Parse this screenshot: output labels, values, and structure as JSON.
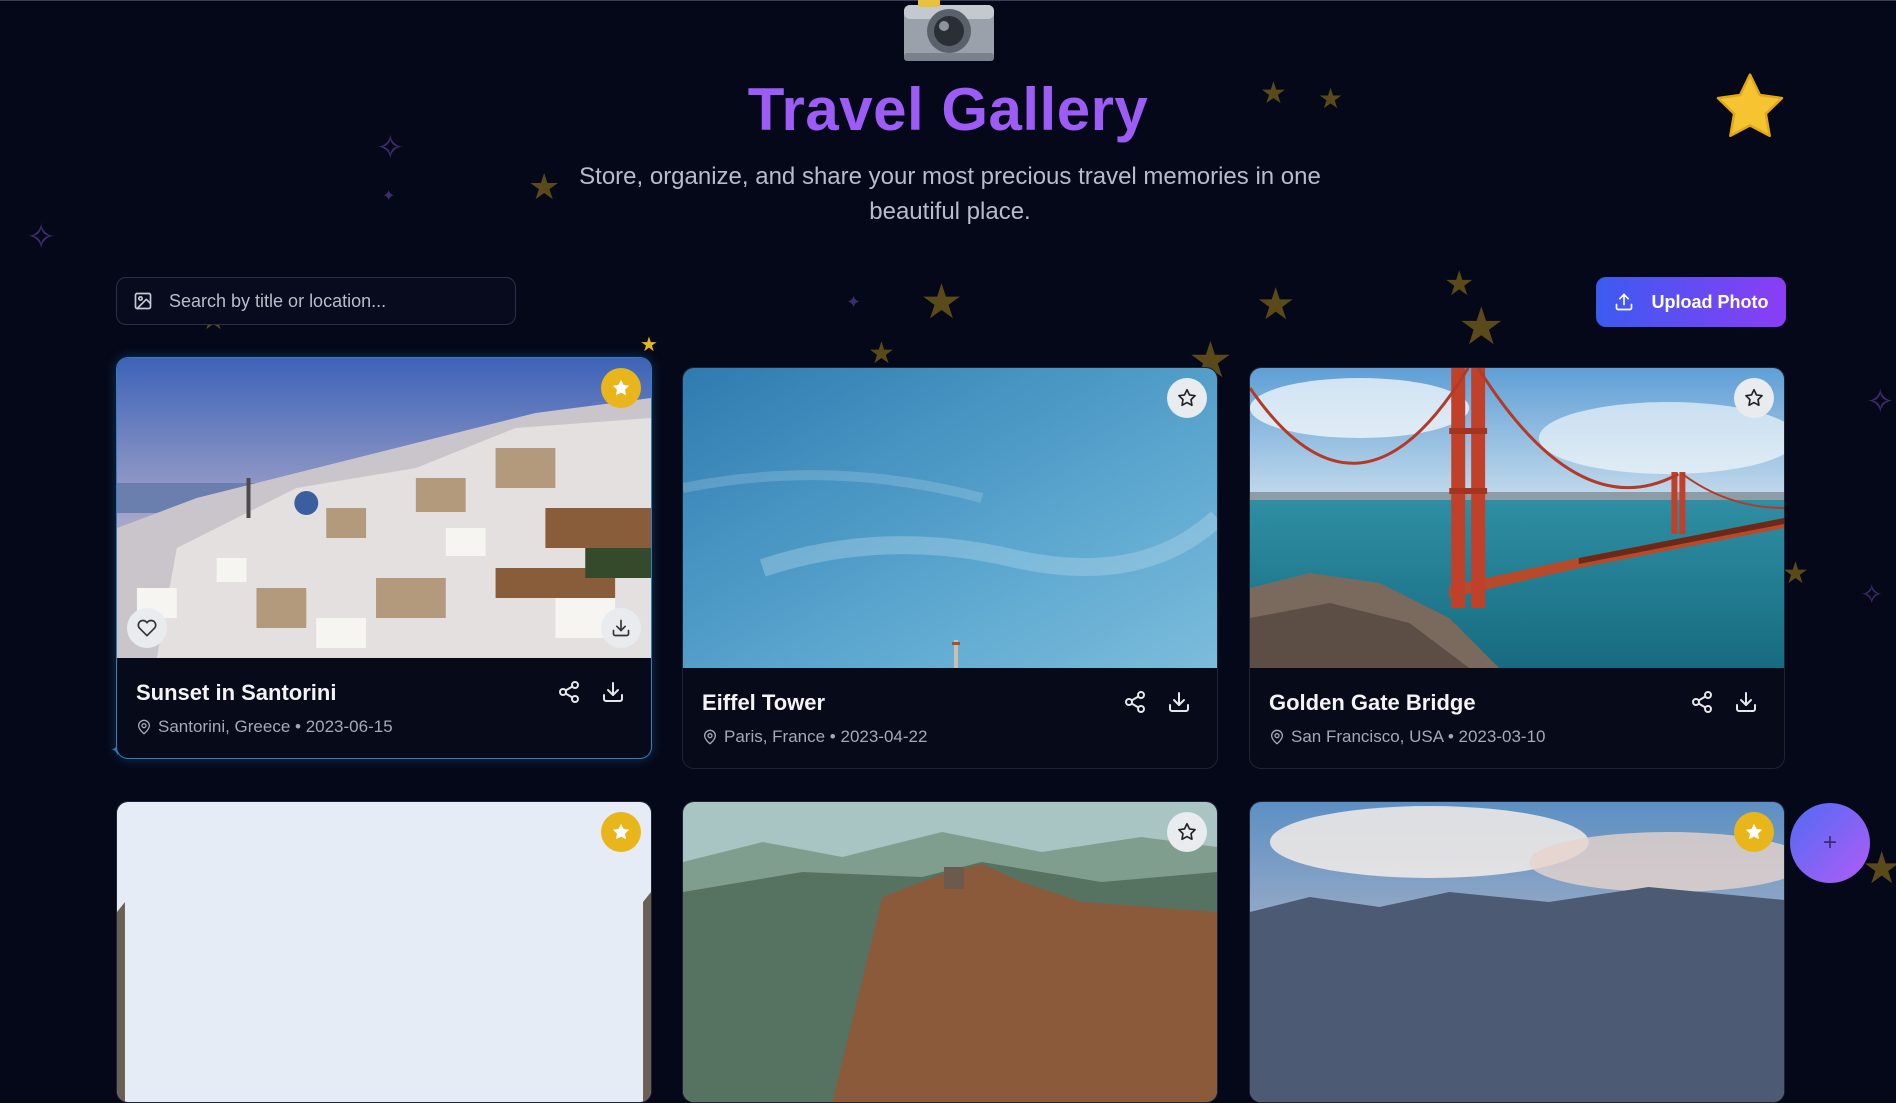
{
  "header": {
    "title": "Travel Gallery",
    "subtitle": "Store, organize, and share your most precious travel memories in one beautiful place."
  },
  "toolbar": {
    "search_placeholder": "Search by title or location...",
    "upload_label": "Upload Photo"
  },
  "fab": {
    "label": "+"
  },
  "photos": [
    {
      "title": "Sunset in Santorini",
      "location": "Santorini, Greece",
      "date": "2023-06-15",
      "meta": "Santorini, Greece • 2023-06-15",
      "favorite": true,
      "hovered": true
    },
    {
      "title": "Eiffel Tower",
      "location": "Paris, France",
      "date": "2023-04-22",
      "meta": "Paris, France • 2023-04-22",
      "favorite": false,
      "hovered": false
    },
    {
      "title": "Golden Gate Bridge",
      "location": "San Francisco, USA",
      "date": "2023-03-10",
      "meta": "San Francisco, USA • 2023-03-10",
      "favorite": false,
      "hovered": false
    },
    {
      "favorite": true
    },
    {
      "favorite": false
    },
    {
      "favorite": true
    }
  ],
  "colors": {
    "background": "#050818",
    "title_gradient": "#9d5cf5",
    "accent_start": "#3b5bf0",
    "accent_end": "#8b3df5",
    "favorite": "#e8b61a"
  },
  "icons": [
    "camera-icon",
    "image-icon",
    "upload-icon",
    "star-icon",
    "heart-icon",
    "download-icon",
    "share-icon",
    "map-pin-icon",
    "plus-icon"
  ]
}
